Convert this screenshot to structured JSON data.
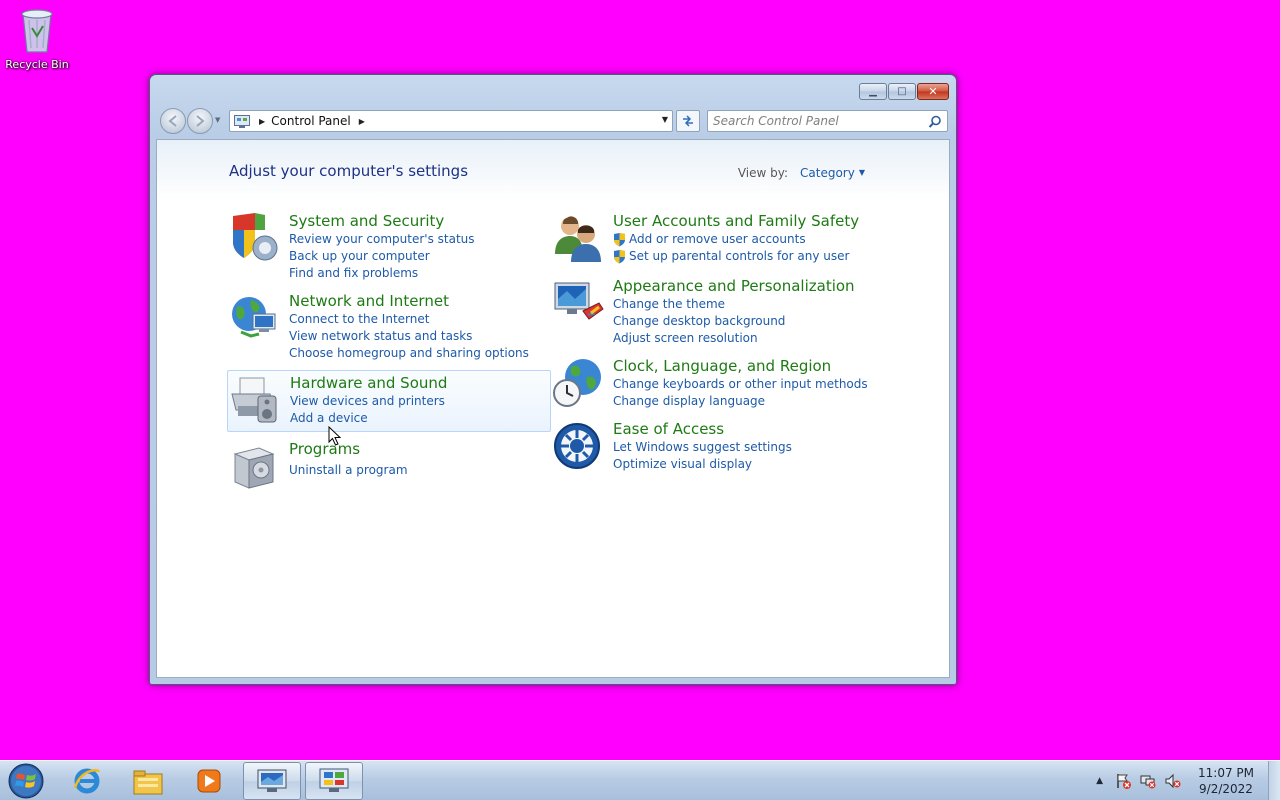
{
  "desktop": {
    "icons": [
      {
        "label": "Recycle Bin",
        "icon": "recycle-bin-icon"
      }
    ],
    "background_color": "#ff00ff"
  },
  "window": {
    "caption_buttons": {
      "minimize": "▁",
      "maximize": "□",
      "close": "✕"
    },
    "address": {
      "crumbs": [
        "Control Panel"
      ]
    },
    "search": {
      "placeholder": "Search Control Panel"
    },
    "title": "Adjust your computer's settings",
    "view_by": {
      "label": "View by:",
      "value": "Category"
    }
  },
  "categories": {
    "left": [
      {
        "title": "System and Security",
        "icon": "shield-icon",
        "links": [
          "Review your computer's status",
          "Back up your computer",
          "Find and fix problems"
        ]
      },
      {
        "title": "Network and Internet",
        "icon": "network-globe-icon",
        "links": [
          "Connect to the Internet",
          "View network status and tasks",
          "Choose homegroup and sharing options"
        ]
      },
      {
        "title": "Hardware and Sound",
        "icon": "printer-icon",
        "links": [
          "View devices and printers",
          "Add a device"
        ]
      },
      {
        "title": "Programs",
        "icon": "programs-box-icon",
        "links": [
          "Uninstall a program"
        ]
      }
    ],
    "right": [
      {
        "title": "User Accounts and Family Safety",
        "icon": "users-icon",
        "links": [
          "Add or remove user accounts",
          "Set up parental controls for any user"
        ]
      },
      {
        "title": "Appearance and Personalization",
        "icon": "monitor-paint-icon",
        "links": [
          "Change the theme",
          "Change desktop background",
          "Adjust screen resolution"
        ]
      },
      {
        "title": "Clock, Language, and Region",
        "icon": "clock-globe-icon",
        "links": [
          "Change keyboards or other input methods",
          "Change display language"
        ]
      },
      {
        "title": "Ease of Access",
        "icon": "ease-of-access-icon",
        "links": [
          "Let Windows suggest settings",
          "Optimize visual display"
        ]
      }
    ]
  },
  "taskbar": {
    "items": [
      {
        "name": "internet-explorer-icon",
        "active": false
      },
      {
        "name": "file-explorer-icon",
        "active": false
      },
      {
        "name": "media-player-icon",
        "active": false
      },
      {
        "name": "display-settings-icon",
        "active": true
      },
      {
        "name": "control-panel-icon",
        "active": true
      }
    ],
    "tray": {
      "time": "11:07 PM",
      "date": "9/2/2022"
    }
  },
  "colors": {
    "category_title": "#1e7b14",
    "link": "#1e5aa8",
    "page_title": "#1e3287"
  }
}
